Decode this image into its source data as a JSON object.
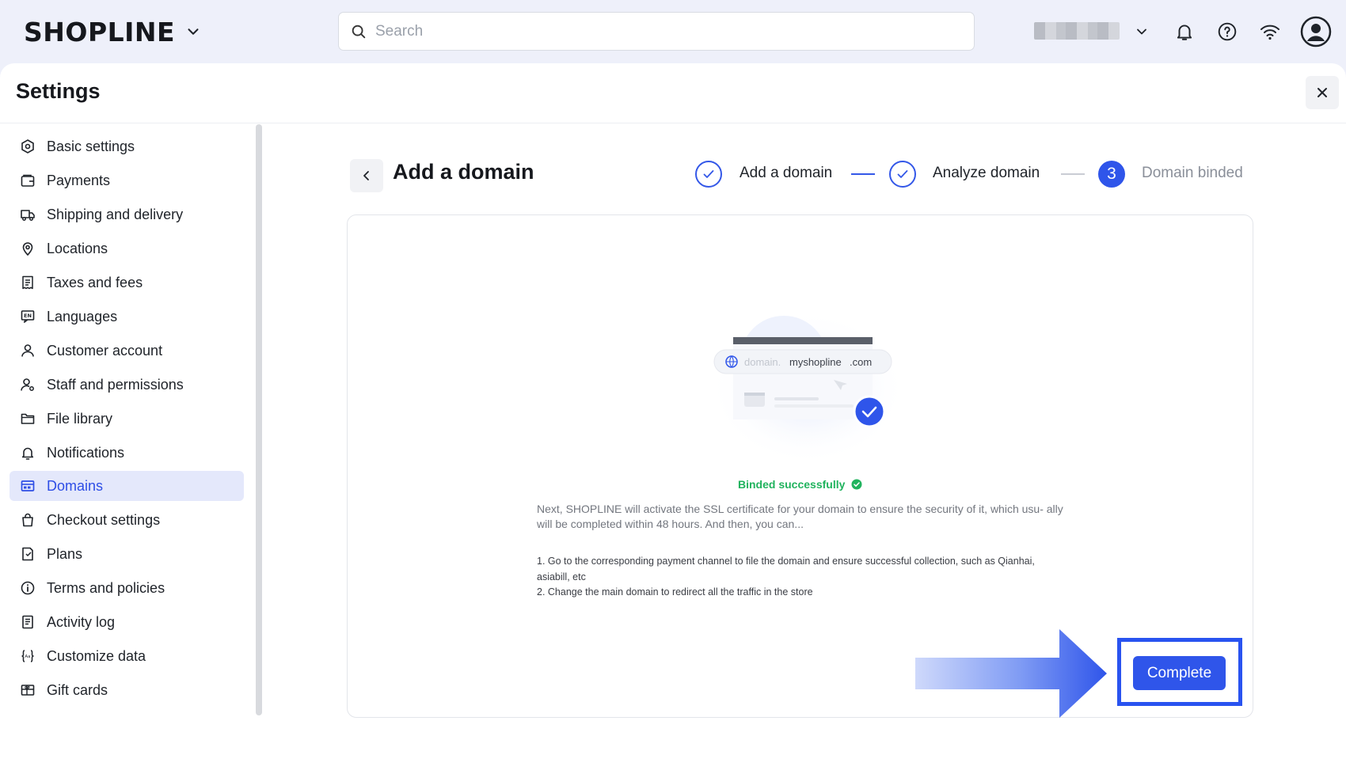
{
  "app": {
    "logo": "SHOPLINE",
    "search_placeholder": "Search"
  },
  "panel": {
    "title": "Settings"
  },
  "sidebar": {
    "items": [
      {
        "label": "Basic settings",
        "icon": "settings-hex-icon"
      },
      {
        "label": "Payments",
        "icon": "wallet-icon"
      },
      {
        "label": "Shipping and delivery",
        "icon": "truck-icon"
      },
      {
        "label": "Locations",
        "icon": "location-pin-icon"
      },
      {
        "label": "Taxes and fees",
        "icon": "receipt-icon"
      },
      {
        "label": "Languages",
        "icon": "language-icon"
      },
      {
        "label": "Customer account",
        "icon": "user-icon"
      },
      {
        "label": "Staff and permissions",
        "icon": "user-gear-icon"
      },
      {
        "label": "File library",
        "icon": "folder-icon"
      },
      {
        "label": "Notifications",
        "icon": "bell-icon"
      },
      {
        "label": "Domains",
        "icon": "domain-icon",
        "active": true
      },
      {
        "label": "Checkout settings",
        "icon": "shopping-bag-icon"
      },
      {
        "label": "Plans",
        "icon": "plan-icon"
      },
      {
        "label": "Terms and policies",
        "icon": "info-icon"
      },
      {
        "label": "Activity log",
        "icon": "log-icon"
      },
      {
        "label": "Customize data",
        "icon": "code-braces-icon"
      },
      {
        "label": "Gift cards",
        "icon": "gift-card-icon"
      }
    ]
  },
  "content": {
    "title": "Add a domain",
    "steps": [
      {
        "label": "Add a domain",
        "state": "done"
      },
      {
        "label": "Analyze domain",
        "state": "done"
      },
      {
        "label": "Domain binded",
        "number": "3",
        "state": "current"
      }
    ],
    "illustration": {
      "domain_prefix": "domain.",
      "domain_name": "myshopline",
      "domain_suffix": ".com"
    },
    "success_text": "Binded successfully",
    "description": "Next, SHOPLINE will activate the SSL certificate for your domain to ensure the security of it, which usu- ally will be completed within 48 hours. And then, you can...",
    "instructions": [
      "1. Go to the corresponding payment channel to file the domain and ensure successful collection, such as Qianhai, asiabill, etc",
      "2. Change the main domain to redirect all the traffic in the store"
    ],
    "complete_label": "Complete"
  },
  "colors": {
    "accent": "#2f55ea",
    "success": "#21b35e",
    "active_bg": "#e4e8fb"
  }
}
